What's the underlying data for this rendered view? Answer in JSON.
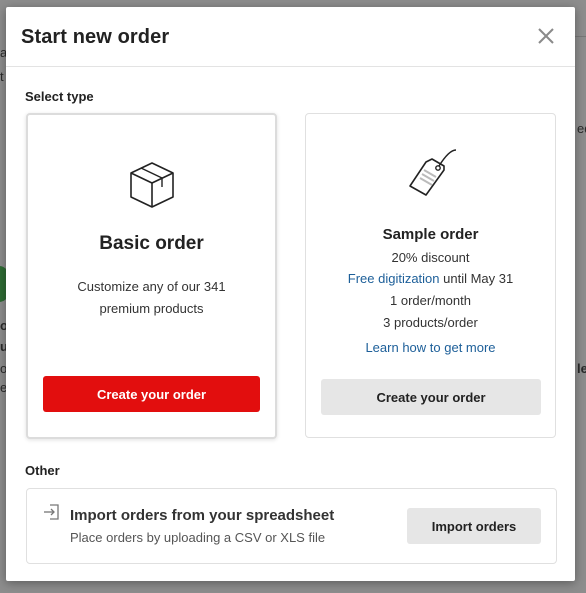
{
  "background": {
    "fragments": [
      "a",
      "t",
      "ed",
      "o",
      "up",
      "o",
      "el",
      "le"
    ]
  },
  "modal": {
    "title": "Start new order",
    "close_icon": "close-icon",
    "select_type_label": "Select type",
    "other_label": "Other"
  },
  "basic_order": {
    "icon": "box-icon",
    "title": "Basic order",
    "description_line1": "Customize any of our 341",
    "description_line2": "premium products",
    "button_label": "Create your order"
  },
  "sample_order": {
    "icon": "price-tag-icon",
    "title": "Sample order",
    "discount": "20% discount",
    "digitization_link": "Free digitization",
    "digitization_suffix": " until May 31",
    "limit_orders": "1 order/month",
    "limit_products": "3 products/order",
    "learn_link": "Learn how to get more",
    "button_label": "Create your order"
  },
  "import": {
    "icon": "import-icon",
    "title": "Import orders from your spreadsheet",
    "subtitle": "Place orders by uploading a CSV or XLS file",
    "button_label": "Import orders"
  },
  "colors": {
    "primary_button": "#e20e0e",
    "link": "#1d5f99",
    "secondary_button": "#e6e6e6"
  }
}
